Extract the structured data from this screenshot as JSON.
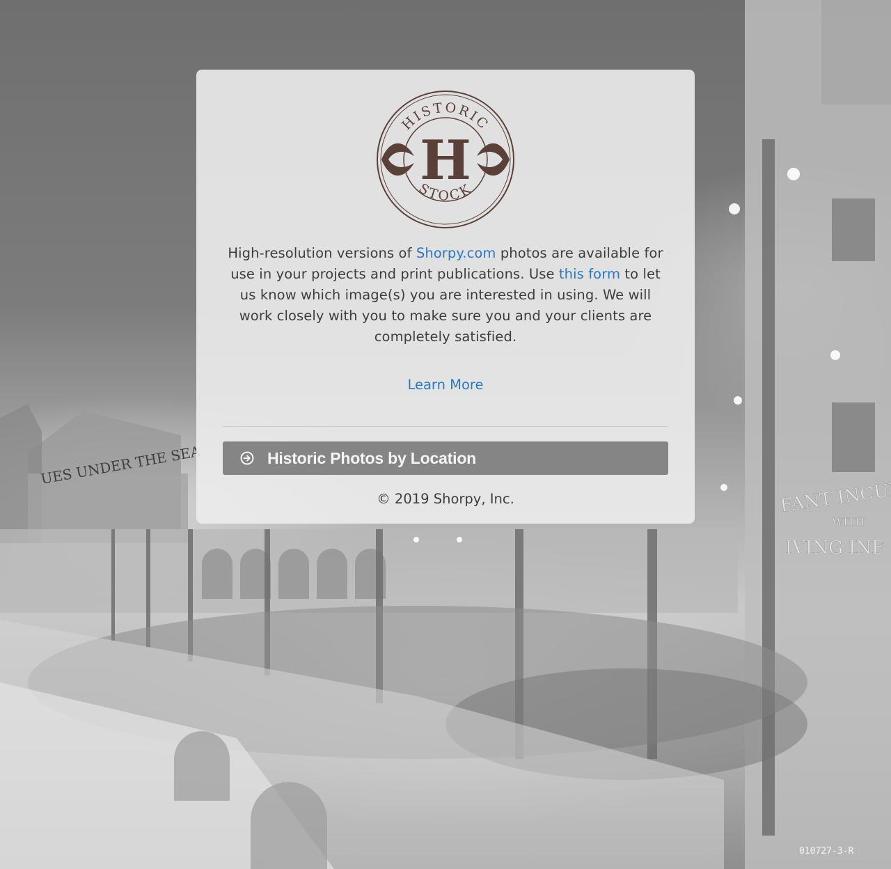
{
  "brand": {
    "logo_top_text": "HISTORIC",
    "logo_monogram": "H",
    "logo_bottom_text": "STOCK",
    "logo_color": "#5a4038"
  },
  "intro": {
    "text_before_link": "High-resolution versions of ",
    "shorpy_link": "Shorpy.com",
    "text_middle": " photos are available for use in your projects and print publications. Use ",
    "form_link": "this form",
    "text_after": " to let us know which image(s) you are interested in using. We will work closely with you to make sure you and your clients are completely satisfied."
  },
  "learn_more": "Learn More",
  "location_button": {
    "icon": "circle-arrow-right-icon",
    "label": "Historic Photos by Location"
  },
  "footer": {
    "copyright": "© 2019 Shorpy, Inc."
  },
  "background": {
    "sign_text_1": "UES UNDER THE SEA",
    "sign_text_2": "FANT INCUB",
    "sign_text_3": "WITH",
    "sign_text_4": "IVING INF",
    "negative_number": "010727-3-R"
  },
  "colors": {
    "link": "#2a78c2",
    "button_bg": "#858585",
    "card_bg": "#ececec",
    "text": "#3d3d3d"
  }
}
